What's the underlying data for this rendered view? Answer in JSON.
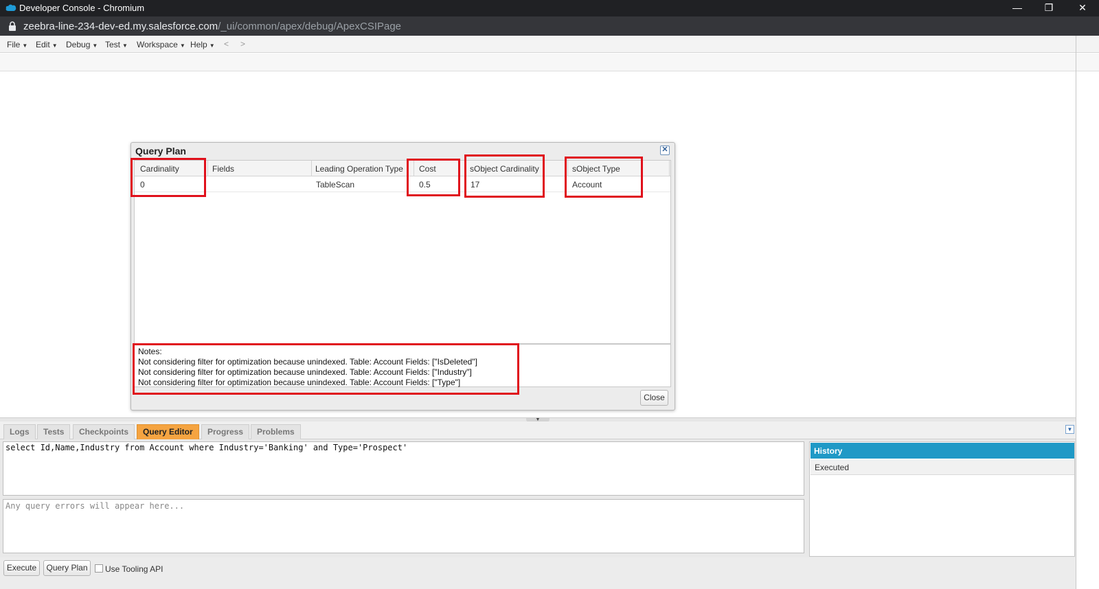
{
  "window": {
    "title": "Developer Console - Chromium",
    "controls": {
      "minimize": "—",
      "maximize": "❐",
      "close": "✕"
    }
  },
  "address": {
    "host": "zeebra-line-234-dev-ed.my.salesforce.com",
    "path": "/_ui/common/apex/debug/ApexCSIPage"
  },
  "menu": {
    "items": [
      "File",
      "Edit",
      "Debug",
      "Test",
      "Workspace",
      "Help"
    ],
    "back": "<",
    "forward": ">"
  },
  "query_plan": {
    "title": "Query Plan",
    "columns": [
      "Cardinality",
      "Fields",
      "Leading Operation Type",
      "Cost",
      "sObject Cardinality",
      "sObject Type"
    ],
    "rows": [
      {
        "cardinality": "0",
        "fields": "",
        "leading_operation_type": "TableScan",
        "cost": "0.5",
        "sobject_cardinality": "17",
        "sobject_type": "Account"
      }
    ],
    "notes": [
      "Notes:",
      "Not considering filter for optimization because unindexed. Table: Account Fields: [\"IsDeleted\"]",
      "Not considering filter for optimization because unindexed. Table: Account Fields: [\"Industry\"]",
      "Not considering filter for optimization because unindexed. Table: Account Fields: [\"Type\"]"
    ],
    "close_label": "Close"
  },
  "tabs": [
    "Logs",
    "Tests",
    "Checkpoints",
    "Query Editor",
    "Progress",
    "Problems"
  ],
  "active_tab": "Query Editor",
  "editor": {
    "query": "select Id,Name,Industry from Account where Industry='Banking' and Type='Prospect'",
    "error_placeholder": "Any query errors will appear here..."
  },
  "history": {
    "title": "History",
    "subheader": "Executed"
  },
  "buttons": {
    "execute": "Execute",
    "query_plan": "Query Plan",
    "tooling_label": "Use Tooling API"
  },
  "colors": {
    "highlight": "#e0101b",
    "active_tab": "#f5a441",
    "history_header": "#1f99c6",
    "titlebar": "#202124"
  }
}
